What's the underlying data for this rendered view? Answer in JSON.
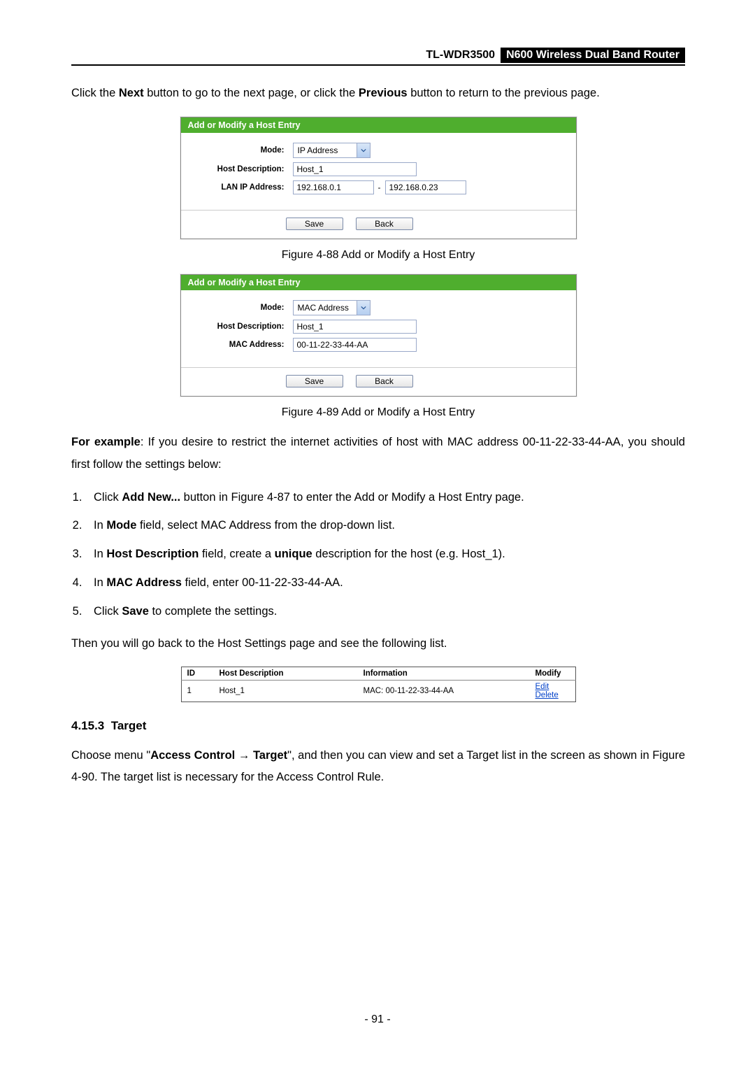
{
  "header": {
    "model": "TL-WDR3500",
    "badge": "N600 Wireless Dual Band Router"
  },
  "intro": {
    "pre": "Click the ",
    "b1": "Next",
    "mid": " button to go to the next page, or click the ",
    "b2": "Previous",
    "post": " button to return to the previous page."
  },
  "fig1": {
    "title": "Add or Modify a Host Entry",
    "mode_label": "Mode:",
    "mode_value": "IP Address",
    "desc_label": "Host Description:",
    "desc_value": "Host_1",
    "addr_label": "LAN IP Address:",
    "ip_from": "192.168.0.1",
    "ip_to": "192.168.0.23",
    "save": "Save",
    "back": "Back",
    "caption": "Figure 4-88 Add or Modify a Host Entry"
  },
  "fig2": {
    "title": "Add or Modify a Host Entry",
    "mode_label": "Mode:",
    "mode_value": "MAC Address",
    "desc_label": "Host Description:",
    "desc_value": "Host_1",
    "addr_label": "MAC Address:",
    "mac": "00-11-22-33-44-AA",
    "save": "Save",
    "back": "Back",
    "caption": "Figure 4-89 Add or Modify a Host Entry"
  },
  "example": {
    "b": "For example",
    "text": ": If you desire to restrict the internet activities of host with MAC address 00-11-22-33-44-AA, you should first follow the settings below:"
  },
  "steps": {
    "s1a": "Click ",
    "s1b": "Add New...",
    "s1c": " button in Figure 4-87 to enter the Add or Modify a Host Entry page.",
    "s2a": "In ",
    "s2b": "Mode",
    "s2c": " field, select MAC Address from the drop-down list.",
    "s3a": "In ",
    "s3b": "Host Description",
    "s3c": " field, create a ",
    "s3d": "unique",
    "s3e": " description for the host (e.g. Host_1).",
    "s4a": "In ",
    "s4b": "MAC Address",
    "s4c": " field, enter 00-11-22-33-44-AA.",
    "s5a": "Click ",
    "s5b": "Save",
    "s5c": " to complete the settings."
  },
  "then": "Then you will go back to the Host Settings page and see the following list.",
  "table": {
    "h_id": "ID",
    "h_desc": "Host Description",
    "h_info": "Information",
    "h_mod": "Modify",
    "r_id": "1",
    "r_desc": "Host_1",
    "r_info": "MAC: 00-11-22-33-44-AA",
    "edit": "Edit",
    "delete": "Delete"
  },
  "section": {
    "num": "4.15.3",
    "title": "Target"
  },
  "target_para": {
    "a": "Choose menu \"",
    "b1": "Access Control",
    "arrow": " → ",
    "b2": "Target",
    "c": "\", and then you can view and set a Target list in the screen as shown in Figure 4-90. The target list is necessary for the Access Control Rule."
  },
  "pagenum": "- 91 -"
}
